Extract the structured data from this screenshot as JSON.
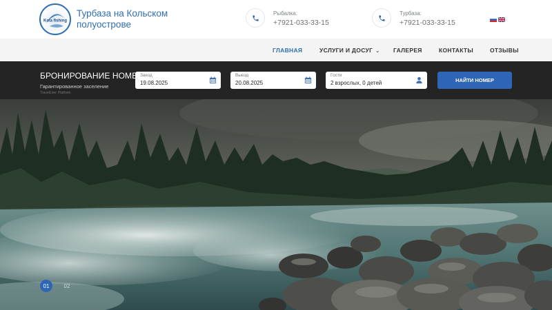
{
  "header": {
    "logo_text": "Kola fishing",
    "site_title": "Турбаза на Кольском полуострове",
    "phones": [
      {
        "label": "Рыбалка:",
        "number": "+7921-033-33-15"
      },
      {
        "label": "Турбаза:",
        "number": "+7921-033-33-15"
      }
    ],
    "languages": [
      "ru",
      "en"
    ]
  },
  "nav": {
    "items": [
      {
        "label": "Главная",
        "active": true
      },
      {
        "label": "Услуги и досуг",
        "dropdown": true
      },
      {
        "label": "Галерея"
      },
      {
        "label": "Контакты"
      },
      {
        "label": "Отзывы"
      }
    ]
  },
  "booking": {
    "title": "Бронирование номеров",
    "subtitle": "Гарантированное заселение",
    "platform": "TravelLine: Platform",
    "checkin": {
      "label": "Заезд",
      "value": "19.08.2025"
    },
    "checkout": {
      "label": "Выезд",
      "value": "20.08.2025"
    },
    "guests": {
      "label": "Гости",
      "value": "2 взрослых, 0 детей"
    },
    "search_label": "Найти номер"
  },
  "slider": {
    "slides": [
      "01",
      "02"
    ],
    "active_index": 0
  },
  "colors": {
    "accent": "#2f65b5",
    "title_blue": "#2f6fb0",
    "booking_bg": "#242424",
    "nav_bg": "#f4f4f4"
  }
}
